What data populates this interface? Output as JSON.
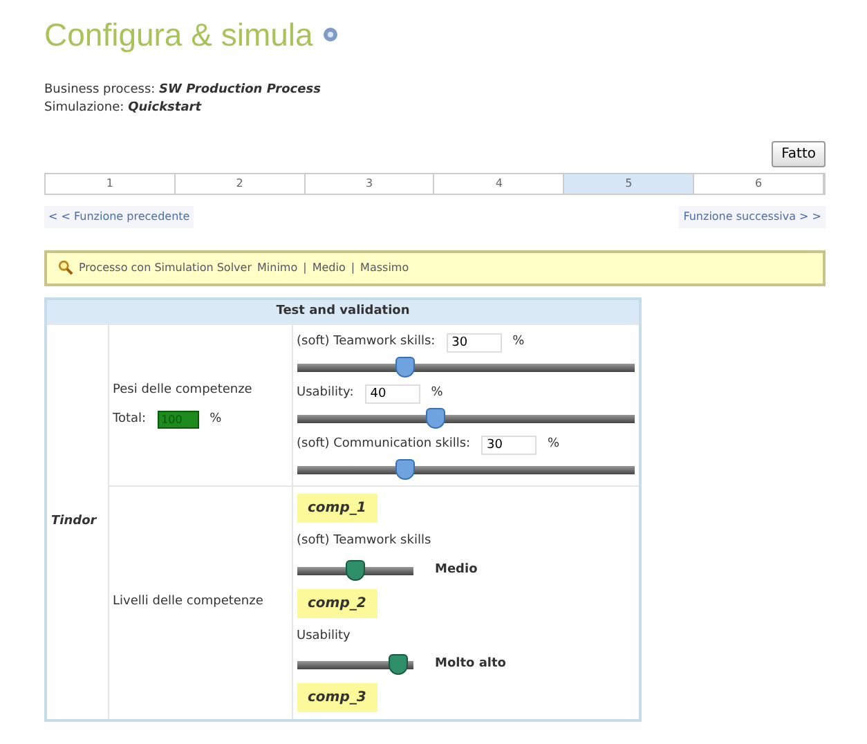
{
  "title": "Configura & simula",
  "info": [
    {
      "label": "Business process:",
      "value": "SW Production Process"
    },
    {
      "label": "Simulazione:",
      "value": "Quickstart"
    }
  ],
  "done_button": "Fatto",
  "steps": [
    {
      "label": "1",
      "selected": false
    },
    {
      "label": "2",
      "selected": false
    },
    {
      "label": "3",
      "selected": false
    },
    {
      "label": "4",
      "selected": false
    },
    {
      "label": "5",
      "selected": true
    },
    {
      "label": "6",
      "selected": false
    }
  ],
  "nav": {
    "previous": "< < Funzione precedente",
    "next": "Funzione successiva > >"
  },
  "notice": {
    "text": "Processo con Simulation Solver",
    "links": [
      "Minimo",
      "Medio",
      "Massimo"
    ],
    "separator": "|"
  },
  "table": {
    "header": "Test and validation",
    "entity": "Tindor",
    "weights": {
      "label": "Pesi delle competenze",
      "total_label": "Total:",
      "total": "100",
      "unit": "%",
      "items": [
        {
          "label": "(soft) Teamwork skills:",
          "value": "30",
          "unit": "%",
          "level": 0.32
        },
        {
          "label": "Usability:",
          "value": "40",
          "unit": "%",
          "level": 0.41
        },
        {
          "label": "(soft) Communication skills:",
          "value": "30",
          "unit": "%",
          "level": 0.32
        }
      ]
    },
    "levels": {
      "label": "Livelli delle competenze",
      "items": [
        {
          "tag": "comp_1",
          "name": "(soft) Teamwork skills",
          "level": 0.5,
          "reading": "Medio"
        },
        {
          "tag": "comp_2",
          "name": "Usability",
          "level": 0.88,
          "reading": "Molto alto"
        },
        {
          "tag": "comp_3"
        }
      ]
    }
  }
}
